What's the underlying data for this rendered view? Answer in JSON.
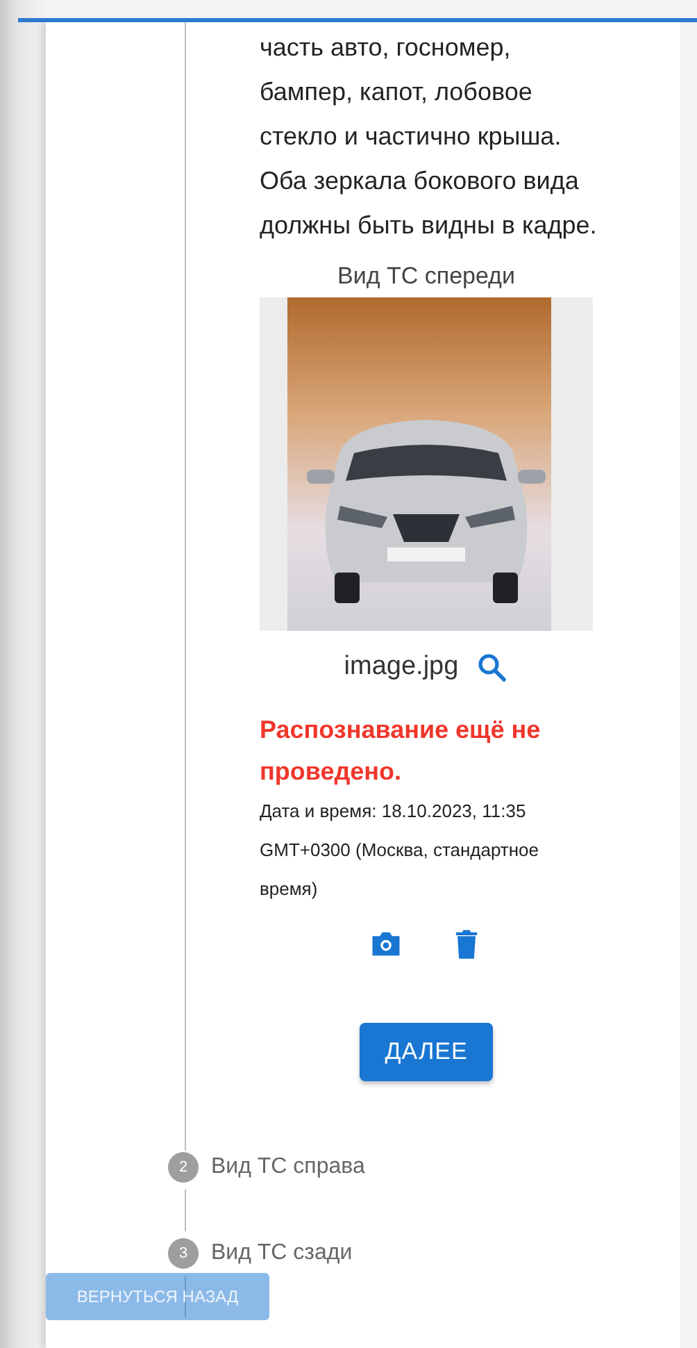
{
  "instructions": "часть авто, госномер, бампер, капот, лобовое стекло и частично крыша. Оба зеркала бокового вида должны быть видны в кадре.",
  "photo": {
    "caption": "Вид ТС спереди",
    "kind": "picture",
    "file_name": "image.jpg"
  },
  "recognition_status": "Распознавание ещё не проведено.",
  "datetime": "Дата и время: 18.10.2023, 11:35 GMT+0300 (Москва, стандартное время)",
  "next_button": "ДАЛЕЕ",
  "steps": [
    {
      "number": "2",
      "label": "Вид ТС справа"
    },
    {
      "number": "3",
      "label": "Вид ТС сзади"
    }
  ],
  "back_button": {
    "label": "ВЕРНУТЬСЯ НАЗАД",
    "disabled": true
  }
}
